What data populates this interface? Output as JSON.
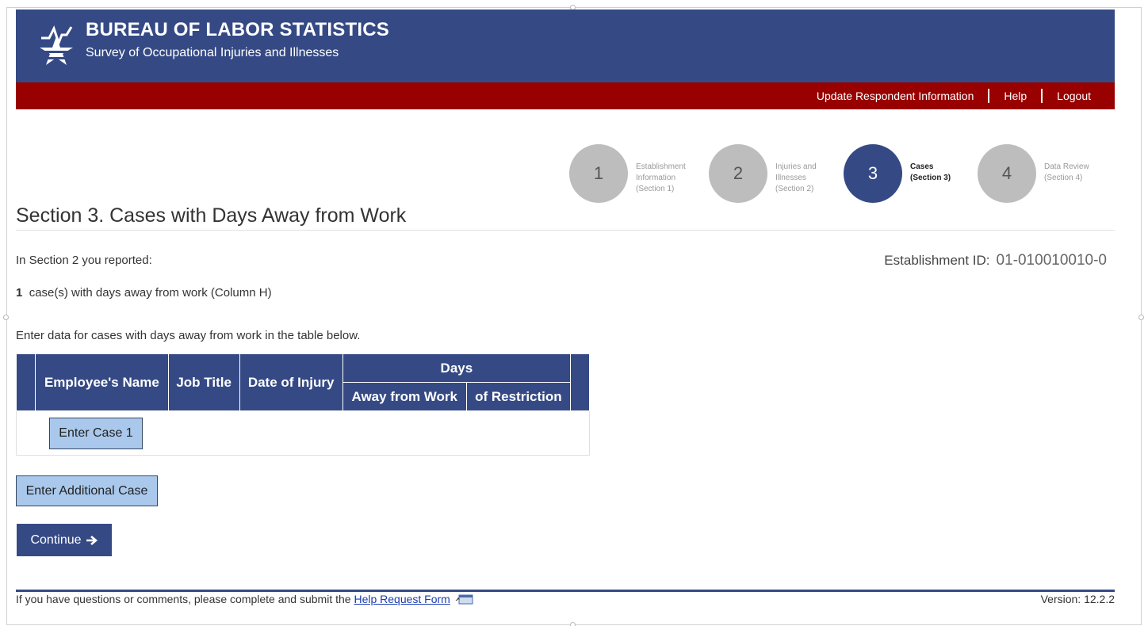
{
  "header": {
    "agency": "BUREAU OF LABOR STATISTICS",
    "survey": "Survey of Occupational Injuries and Illnesses"
  },
  "nav": {
    "update": "Update Respondent Information",
    "help": "Help",
    "logout": "Logout"
  },
  "steps": [
    {
      "number": "1",
      "line1": "Establishment",
      "line2": "Information",
      "line3": "(Section 1)"
    },
    {
      "number": "2",
      "line1": "Injuries and",
      "line2": "Illnesses",
      "line3": "(Section 2)"
    },
    {
      "number": "3",
      "line1": "Cases",
      "line2": "(Section 3)",
      "line3": ""
    },
    {
      "number": "4",
      "line1": "Data Review",
      "line2": "(Section 4)",
      "line3": ""
    }
  ],
  "active_step": "3",
  "page_title": "Section 3. Cases with Days Away from Work",
  "intro": "In Section 2 you reported:",
  "establishment": {
    "label": "Establishment ID:",
    "value": "01-010010010-0"
  },
  "count": {
    "number": "1",
    "text": "case(s) with days away from work (Column H)"
  },
  "instruction": "Enter data for cases with days away from work in the table below.",
  "table": {
    "col_name": "Employee's Name",
    "col_job": "Job Title",
    "col_date": "Date of Injury",
    "days_group": "Days",
    "col_away": "Away from Work",
    "col_restriction": "of Restriction"
  },
  "buttons": {
    "enter_case": "Enter Case 1",
    "additional": "Enter Additional Case",
    "continue": "Continue"
  },
  "footer": {
    "text": "If you have questions or comments, please complete and submit the",
    "link": "Help Request Form",
    "version": "Version: 12.2.2"
  },
  "colors": {
    "navy": "#354a85",
    "dark_red": "#990000",
    "light_button": "#a9c8ec",
    "step_inactive": "#bdbdbd"
  }
}
